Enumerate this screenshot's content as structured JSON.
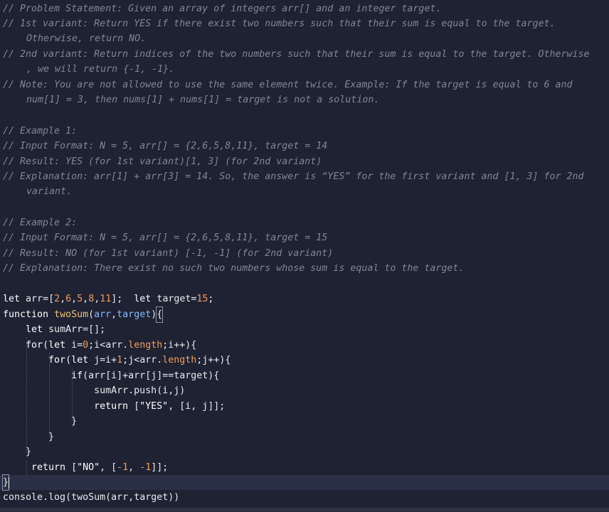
{
  "comments": {
    "l1": "// Problem Statement: Given an array of integers arr[] and an integer target.",
    "l2": "// 1st variant: Return YES if there exist two numbers such that their sum is equal to the target.",
    "l3": "Otherwise, return NO.",
    "l4": "// 2nd variant: Return indices of the two numbers such that their sum is equal to the target. Otherwise",
    "l5": ", we will return {-1, -1}.",
    "l6": "// Note: You are not allowed to use the same element twice. Example: If the target is equal to 6 and",
    "l7": "num[1] = 3, then nums[1] + nums[1] = target is not a solution.",
    "l8": "// Example 1:",
    "l9": "// Input Format: N = 5, arr[] = {2,6,5,8,11}, target = 14",
    "l10": "// Result: YES (for 1st variant)[1, 3] (for 2nd variant)",
    "l11": "// Explanation: arr[1] + arr[3] = 14. So, the answer is “YES” for the first variant and [1, 3] for 2nd",
    "l12": "variant.",
    "l13": "// Example 2:",
    "l14": "// Input Format: N = 5, arr[] = {2,6,5,8,11}, target = 15",
    "l15": "// Result: NO (for 1st variant) [-1, -1] (for 2nd variant)",
    "l16": "// Explanation: There exist no such two numbers whose sum is equal to the target."
  },
  "code": {
    "kw_let": "let",
    "kw_function": "function",
    "kw_for": "for",
    "kw_if": "if",
    "kw_return": "return",
    "var_arr": "arr",
    "var_target": "target",
    "var_sumArr": "sumArr",
    "fn_twoSum": "twoSum",
    "prop_length": "length",
    "arr_literal_open": "=[",
    "arr_values": [
      "2",
      "6",
      "5",
      "8",
      "11"
    ],
    "yes": "\"YES\"",
    "no": "\"NO\"",
    "console_log": "console.log",
    "push": "push",
    "minus_one": "-1"
  },
  "colors": {
    "background": "#1e2233",
    "comment": "#7e8798",
    "number": "#f29d59",
    "function": "#f0c472",
    "parameter": "#89b8ff"
  }
}
